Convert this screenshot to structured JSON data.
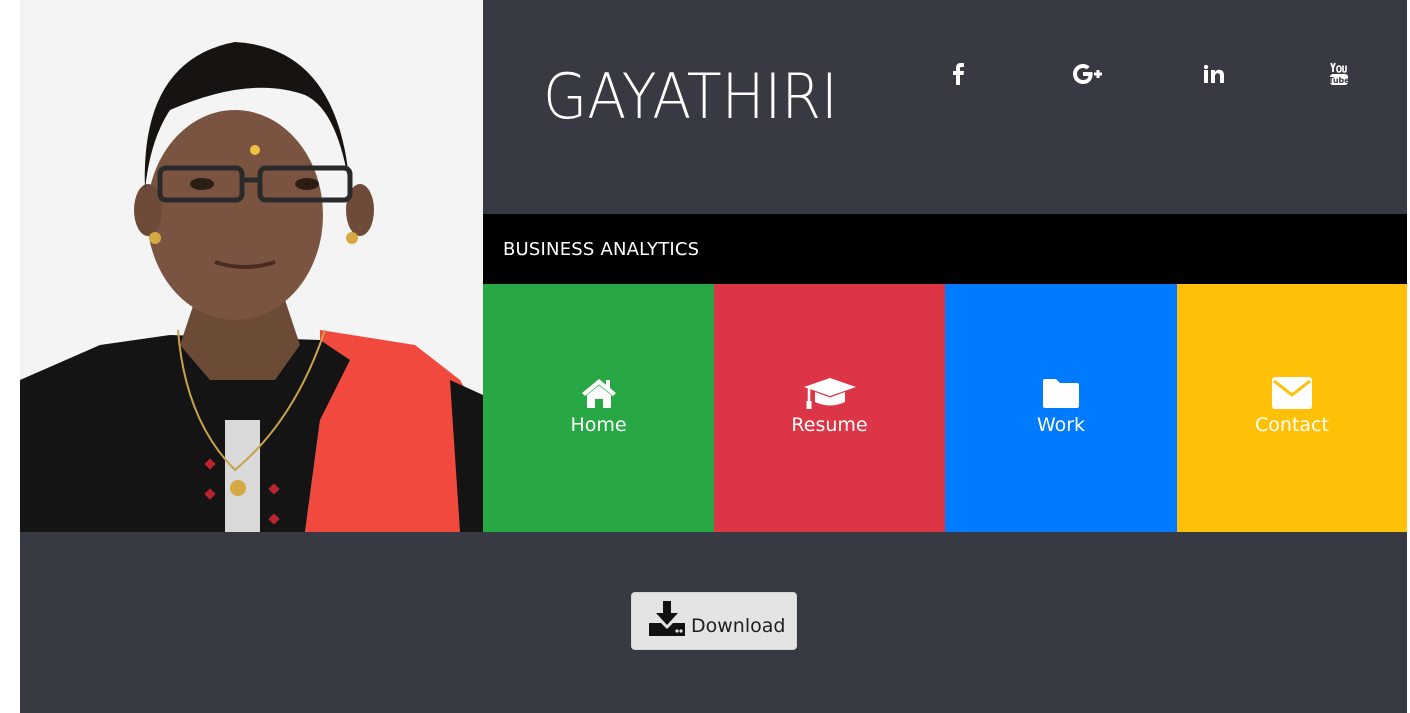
{
  "profile": {
    "name": "GAYATHIRI",
    "tagline": "BUSINESS ANALYTICS",
    "photo_icon": "profile-photo"
  },
  "social": [
    {
      "id": "facebook",
      "icon": "facebook-icon"
    },
    {
      "id": "google-plus",
      "icon": "google-plus-icon"
    },
    {
      "id": "linkedin",
      "icon": "linkedin-icon"
    },
    {
      "id": "youtube",
      "icon": "youtube-icon"
    }
  ],
  "nav": {
    "items": [
      {
        "label": "Home",
        "icon": "home-icon",
        "color": "#28a745"
      },
      {
        "label": "Resume",
        "icon": "graduation-cap-icon",
        "color": "#dc3545"
      },
      {
        "label": "Work",
        "icon": "folder-icon",
        "color": "#007bff"
      },
      {
        "label": "Contact",
        "icon": "envelope-icon",
        "color": "#ffc107"
      }
    ]
  },
  "footer": {
    "download_label": "Download",
    "download_icon": "download-icon"
  },
  "colors": {
    "header_bg": "#373a42",
    "subtitle_bg": "#000000",
    "button_bg": "#e4e4e4"
  }
}
